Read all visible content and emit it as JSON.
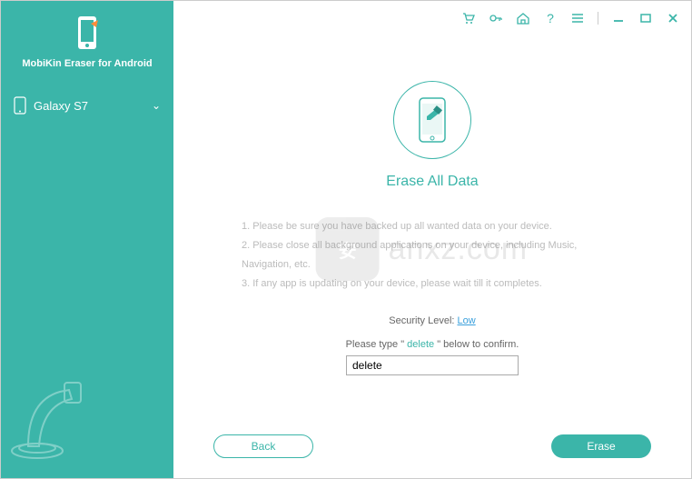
{
  "sidebar": {
    "product_name": "MobiKin Eraser for Android",
    "device_name": "Galaxy S7"
  },
  "main": {
    "title": "Erase All Data",
    "instructions": {
      "line1": "1. Please be sure you have backed up all wanted data on your device.",
      "line2": "2. Please close all background applications on your device, including Music, Navigation, etc.",
      "line3": "3. If any app is updating on your device, please wait till it completes."
    },
    "security_label": "Security Level: ",
    "security_value": "Low",
    "confirm_prefix": "Please type \" ",
    "confirm_keyword": "delete",
    "confirm_suffix": " \" below to confirm.",
    "input_value": "delete"
  },
  "buttons": {
    "back": "Back",
    "erase": "Erase"
  },
  "watermark": {
    "badge": "安",
    "text": "anxz.com"
  }
}
